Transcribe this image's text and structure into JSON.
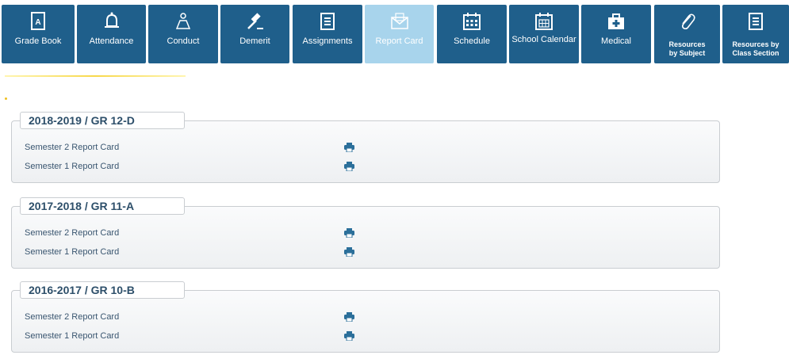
{
  "tabs": [
    {
      "label": "Grade Book",
      "icon": "gradebook-icon",
      "active": false
    },
    {
      "label": "Attendance",
      "icon": "bell-icon",
      "active": false
    },
    {
      "label": "Conduct",
      "icon": "conduct-icon",
      "active": false
    },
    {
      "label": "Demerit",
      "icon": "gavel-icon",
      "active": false
    },
    {
      "label": "Assignments",
      "icon": "checklist-icon",
      "active": false
    },
    {
      "label": "Report Card",
      "icon": "envelope-icon",
      "active": true
    },
    {
      "label": "Schedule",
      "icon": "calendar-icon",
      "active": false
    },
    {
      "label": "School Calendar",
      "icon": "calendar-grid-icon",
      "active": false
    },
    {
      "label": "Medical",
      "icon": "medical-kit-icon",
      "active": false
    },
    {
      "label": "Resources by Subject",
      "icon": "paperclip-icon",
      "active": false
    },
    {
      "label": "Resources by Class Section",
      "icon": "list-icon",
      "active": false
    }
  ],
  "groups": [
    {
      "title": "2018-2019 / GR 12-D",
      "items": [
        {
          "label": "Semester 2 Report Card",
          "action": "print-icon"
        },
        {
          "label": "Semester 1 Report Card",
          "action": "print-icon"
        }
      ]
    },
    {
      "title": "2017-2018 / GR 11-A",
      "items": [
        {
          "label": "Semester 2 Report Card",
          "action": "print-icon"
        },
        {
          "label": "Semester 1 Report Card",
          "action": "print-icon"
        }
      ]
    },
    {
      "title": "2016-2017 / GR 10-B",
      "items": [
        {
          "label": "Semester 2 Report Card",
          "action": "print-icon"
        },
        {
          "label": "Semester 1 Report Card",
          "action": "print-icon"
        }
      ]
    }
  ],
  "colors": {
    "tab": "#1f5f8b",
    "tab_active": "#a8d4ec",
    "title_text": "#2d4f6a",
    "link_text": "#3a5670",
    "print_icon": "#2b6f9a"
  }
}
